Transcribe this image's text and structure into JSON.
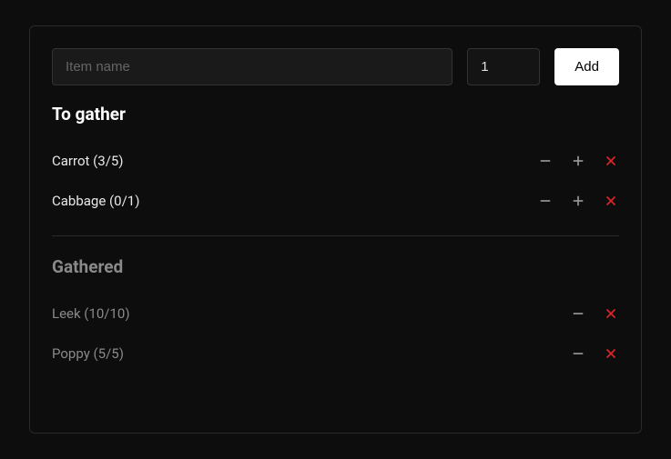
{
  "input": {
    "placeholder": "Item name",
    "value": ""
  },
  "qty": {
    "value": "1"
  },
  "add_button": "Add",
  "to_gather": {
    "title": "To gather",
    "items": [
      {
        "label": "Carrot (3/5)"
      },
      {
        "label": "Cabbage (0/1)"
      }
    ]
  },
  "gathered": {
    "title": "Gathered",
    "items": [
      {
        "label": "Leek (10/10)"
      },
      {
        "label": "Poppy (5/5)"
      }
    ]
  }
}
